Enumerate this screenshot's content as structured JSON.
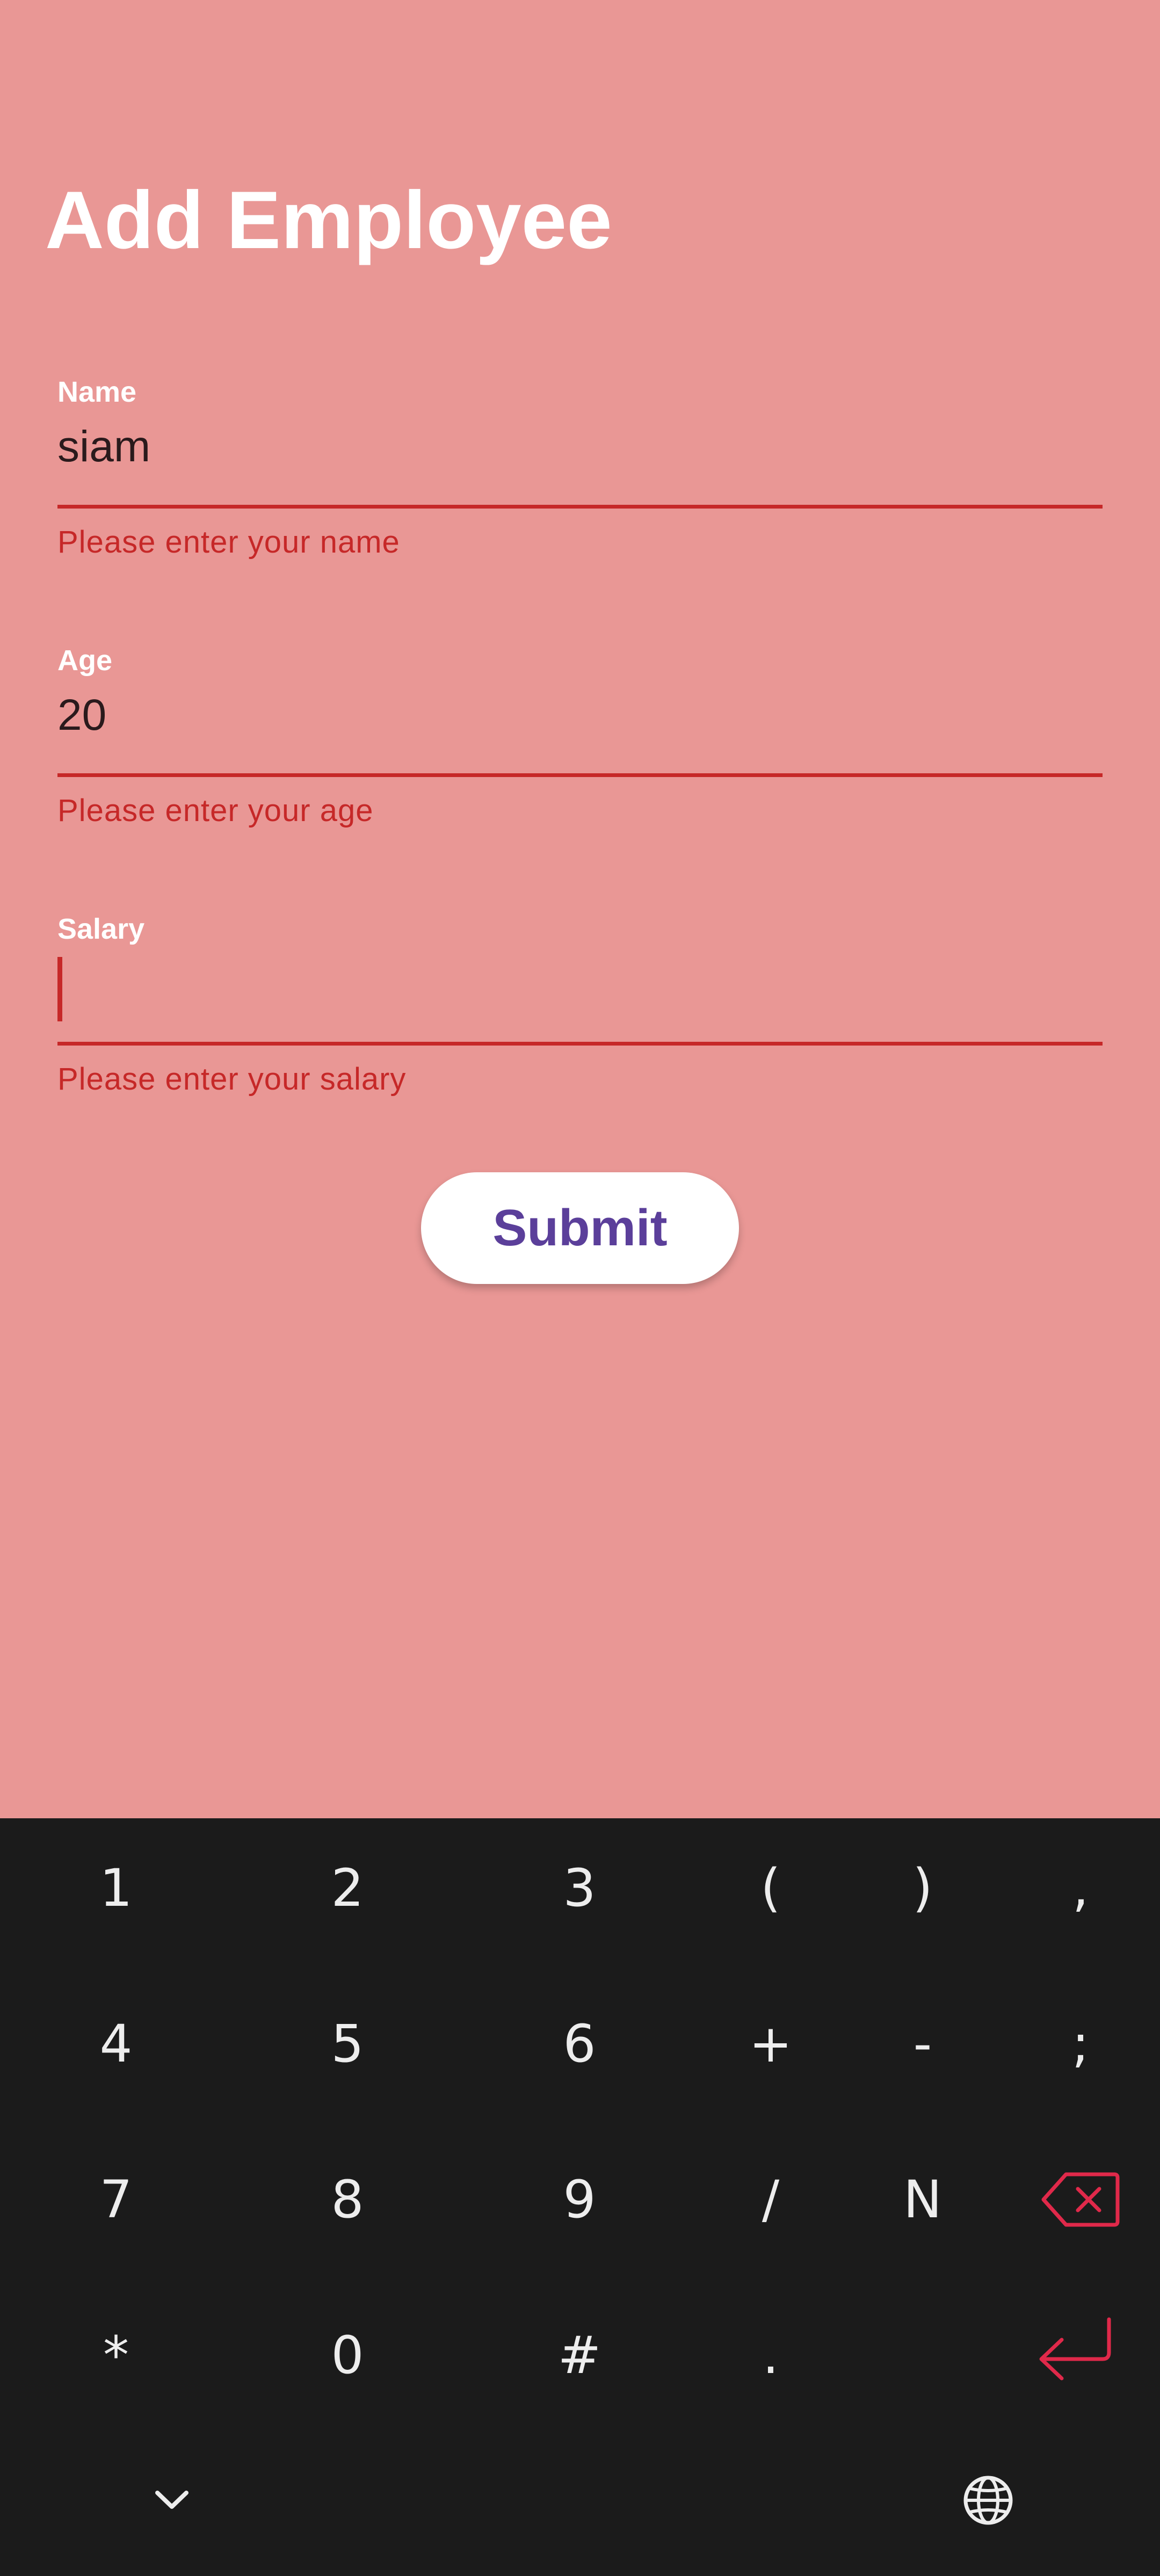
{
  "page": {
    "title": "Add Employee"
  },
  "form": {
    "fields": [
      {
        "label": "Name",
        "value": "siam",
        "error": "Please enter your name"
      },
      {
        "label": "Age",
        "value": "20",
        "error": "Please enter your age"
      },
      {
        "label": "Salary",
        "value": "",
        "error": "Please enter your salary"
      }
    ],
    "submit_label": "Submit"
  },
  "keyboard": {
    "rows": [
      [
        "1",
        "2",
        "3",
        "(",
        ")",
        ","
      ],
      [
        "4",
        "5",
        "6",
        "+",
        "-",
        ";"
      ],
      [
        "7",
        "8",
        "9",
        "/",
        "N"
      ],
      [
        "*",
        "0",
        "#",
        "."
      ]
    ],
    "icons": [
      "backspace-icon",
      "enter-icon",
      "chevron-down-icon",
      "globe-icon"
    ],
    "accent_color": "#e0294a"
  },
  "colors": {
    "background": "#e99795",
    "error": "#c62828",
    "title": "#ffffff",
    "button_text": "#5b3f9a",
    "keyboard_bg": "#1b1b1b"
  }
}
